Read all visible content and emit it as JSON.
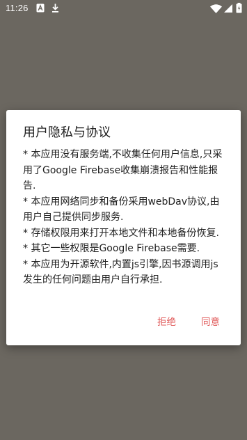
{
  "status_bar": {
    "time": "11:26",
    "icons": [
      "notification-a-icon",
      "download-icon",
      "wifi-icon",
      "signal-icon",
      "battery-icon"
    ]
  },
  "dialog": {
    "title": "用户隐私与协议",
    "paragraphs": [
      "* 本应用没有服务端,不收集任何用户信息,只采用了Google Firebase收集崩溃报告和性能报告.",
      "* 本应用网络同步和备份采用webDav协议,由用户自己提供同步服务.",
      "* 存储权限用来打开本地文件和本地备份恢复.",
      "* 其它一些权限是Google Firebase需要.",
      "* 本应用为开源软件,内置js引擎,因书源调用js发生的任何问题由用户自行承担."
    ],
    "reject_label": "拒绝",
    "accept_label": "同意"
  },
  "colors": {
    "scrim": "#6b6760",
    "dialog_background": "#ffffff",
    "accent": "#e05a5a",
    "text": "#222222"
  }
}
